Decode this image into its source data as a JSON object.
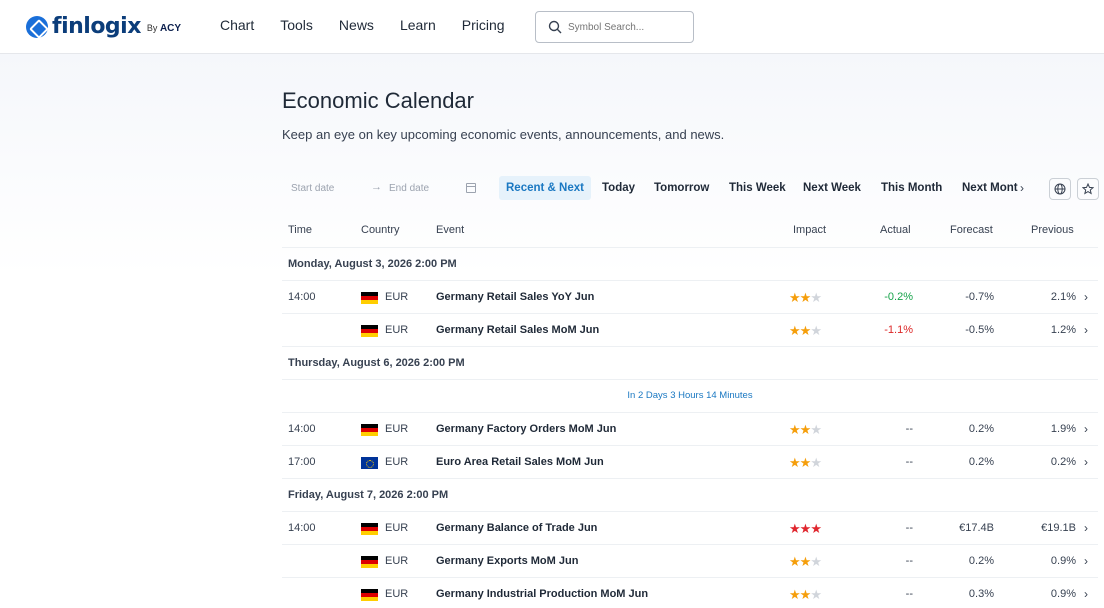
{
  "brand": {
    "name": "finlogix",
    "by": "By",
    "partner": "ACY"
  },
  "nav": [
    "Chart",
    "Tools",
    "News",
    "Learn",
    "Pricing"
  ],
  "search": {
    "placeholder": "Symbol Search..."
  },
  "page": {
    "title": "Economic Calendar",
    "subtitle": "Keep an eye on key upcoming economic events, announcements, and news."
  },
  "filters": {
    "start_placeholder": "Start date",
    "end_placeholder": "End date",
    "arrow": "→",
    "tabs": [
      "Recent & Next",
      "Today",
      "Tomorrow",
      "This Week",
      "Next Week",
      "This Month",
      "Next Mont"
    ],
    "active_tab": "Recent & Next"
  },
  "table": {
    "headers": [
      "Time",
      "Country",
      "Event",
      "Impact",
      "Actual",
      "Forecast",
      "Previous"
    ],
    "groups": [
      {
        "date": "Monday, August 3, 2026 2:00 PM",
        "rows": [
          {
            "time": "14:00",
            "flag": "de",
            "currency": "EUR",
            "event": "Germany Retail Sales YoY Jun",
            "impact": 2,
            "actual": "-0.2%",
            "actual_tone": "pos",
            "forecast": "-0.7%",
            "previous": "2.1%"
          },
          {
            "time": "",
            "flag": "de",
            "currency": "EUR",
            "event": "Germany Retail Sales MoM Jun",
            "impact": 2,
            "actual": "-1.1%",
            "actual_tone": "neg",
            "forecast": "-0.5%",
            "previous": "1.2%"
          }
        ]
      },
      {
        "date": "Thursday, August 6, 2026 2:00 PM",
        "countdown": "In 2 Days 3 Hours 14 Minutes",
        "rows": [
          {
            "time": "14:00",
            "flag": "de",
            "currency": "EUR",
            "event": "Germany Factory Orders MoM Jun",
            "impact": 2,
            "actual": "--",
            "actual_tone": "",
            "forecast": "0.2%",
            "previous": "1.9%"
          },
          {
            "time": "17:00",
            "flag": "eu",
            "currency": "EUR",
            "event": "Euro Area Retail Sales MoM Jun",
            "impact": 2,
            "actual": "--",
            "actual_tone": "",
            "forecast": "0.2%",
            "previous": "0.2%"
          }
        ]
      },
      {
        "date": "Friday, August 7, 2026 2:00 PM",
        "rows": [
          {
            "time": "14:00",
            "flag": "de",
            "currency": "EUR",
            "event": "Germany Balance of Trade Jun",
            "impact": 3,
            "actual": "--",
            "actual_tone": "",
            "forecast": "€17.4B",
            "previous": "€19.1B"
          },
          {
            "time": "",
            "flag": "de",
            "currency": "EUR",
            "event": "Germany Exports MoM Jun",
            "impact": 2,
            "actual": "--",
            "actual_tone": "",
            "forecast": "0.2%",
            "previous": "0.9%"
          },
          {
            "time": "",
            "flag": "de",
            "currency": "EUR",
            "event": "Germany Industrial Production MoM Jun",
            "impact": 2,
            "actual": "--",
            "actual_tone": "",
            "forecast": "0.3%",
            "previous": "0.9%"
          }
        ]
      }
    ]
  },
  "colors": {
    "accent": "#1a78c2",
    "positive": "#16a34a",
    "negative": "#dc2626",
    "star": "#f59e0b",
    "star_high": "#e0262e"
  }
}
